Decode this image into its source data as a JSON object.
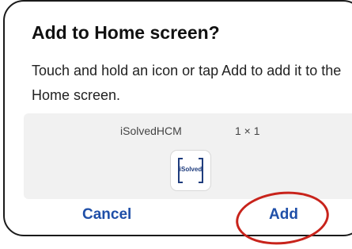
{
  "dialog": {
    "title": "Add to Home screen?",
    "message": "Touch and hold an icon or tap Add to add it to the Home screen.",
    "preview": {
      "app_name": "iSolvedHCM",
      "app_size": "1 × 1",
      "icon": "isolved-app-icon",
      "icon_logo_text": "iSolved"
    },
    "buttons": {
      "cancel_label": "Cancel",
      "add_label": "Add"
    }
  },
  "colors": {
    "button_text": "#1f4fa8",
    "annotation_circle": "#c8231b",
    "preview_background": "#f1f1f1"
  }
}
